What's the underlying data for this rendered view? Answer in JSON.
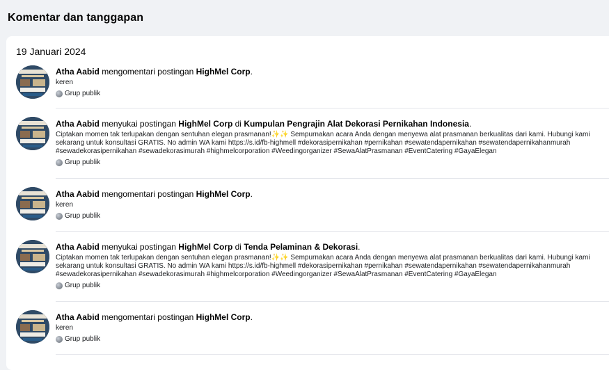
{
  "page_title": "Komentar dan tanggapan",
  "date": "19 Januari 2024",
  "items": [
    {
      "actor": "Atha Aabid",
      "verb": " mengomentari postingan ",
      "target": "HighMel Corp",
      "connector": "",
      "group": "",
      "end": ".",
      "body": "keren",
      "audience": "Grup publik"
    },
    {
      "actor": "Atha Aabid",
      "verb": " menyukai postingan ",
      "target": "HighMel Corp",
      "connector": " di ",
      "group": "Kumpulan Pengrajin Alat Dekorasi Pernikahan Indonesia",
      "end": ".",
      "body": "Ciptakan momen tak terlupakan dengan sentuhan elegan prasmanan!✨✨ Sempurnakan acara Anda dengan menyewa alat prasmanan berkualitas dari kami. Hubungi kami sekarang untuk konsultasi GRATIS. No admin WA kami https://s.id/fb-highmell #dekorasipernikahan #pernikahan #sewatendapernikahan #sewatendapernikahanmurah #sewadekorasipernikahan #sewadekorasimurah #highmelcorporation #Weedingorganizer #SewaAlatPrasmanan #EventCatering #GayaElegan",
      "audience": "Grup publik"
    },
    {
      "actor": "Atha Aabid",
      "verb": " mengomentari postingan ",
      "target": "HighMel Corp",
      "connector": "",
      "group": "",
      "end": ".",
      "body": "keren",
      "audience": "Grup publik"
    },
    {
      "actor": "Atha Aabid",
      "verb": " menyukai postingan ",
      "target": "HighMel Corp",
      "connector": " di ",
      "group": "Tenda Pelaminan & Dekorasi",
      "end": ".",
      "body": "Ciptakan momen tak terlupakan dengan sentuhan elegan prasmanan!✨✨ Sempurnakan acara Anda dengan menyewa alat prasmanan berkualitas dari kami. Hubungi kami sekarang untuk konsultasi GRATIS. No admin WA kami https://s.id/fb-highmell #dekorasipernikahan #pernikahan #sewatendapernikahan #sewatendapernikahanmurah #sewadekorasipernikahan #sewadekorasimurah #highmelcorporation #Weedingorganizer #SewaAlatPrasmanan #EventCatering #GayaElegan",
      "audience": "Grup publik"
    },
    {
      "actor": "Atha Aabid",
      "verb": " mengomentari postingan ",
      "target": "HighMel Corp",
      "connector": "",
      "group": "",
      "end": ".",
      "body": "keren",
      "audience": "Grup publik"
    }
  ]
}
